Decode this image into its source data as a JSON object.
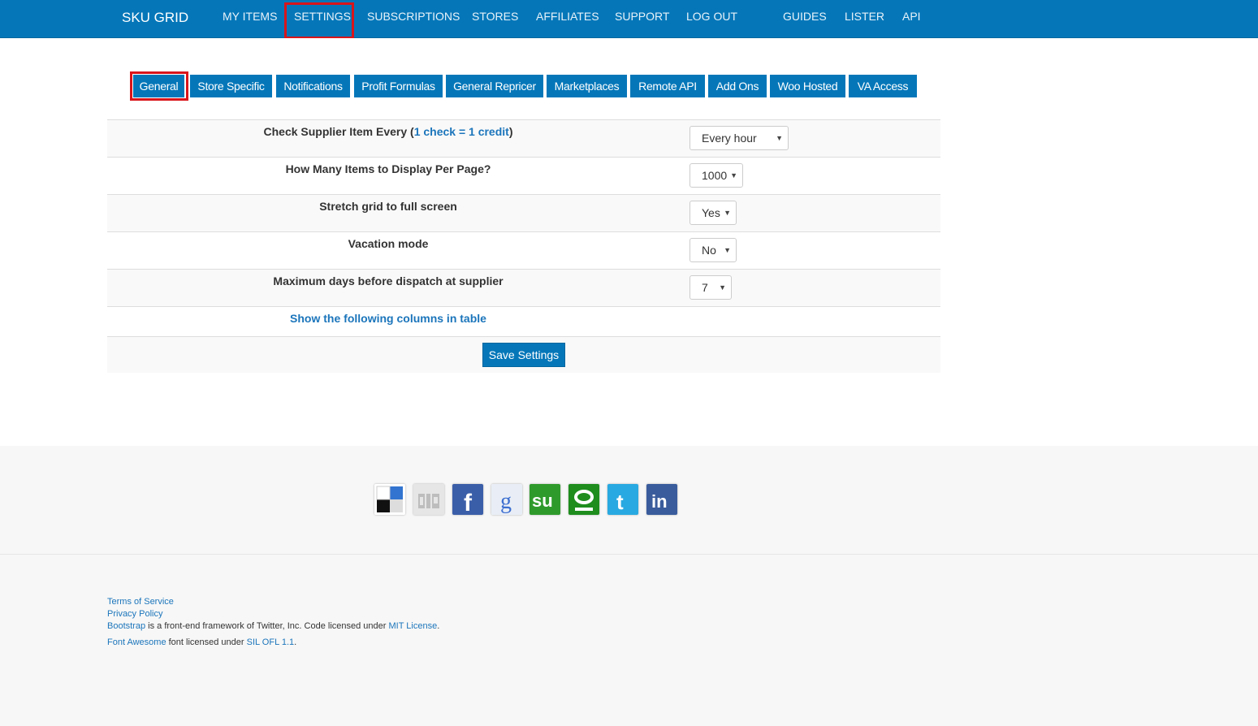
{
  "header": {
    "brand": "SKU GRID",
    "nav": [
      "MY ITEMS",
      "SETTINGS",
      "SUBSCRIPTIONS",
      "STORES",
      "AFFILIATES",
      "SUPPORT",
      "LOG OUT",
      "GUIDES",
      "LISTER",
      "API"
    ],
    "active": "SETTINGS",
    "bg_color": "#0577b9"
  },
  "tabs": [
    "General",
    "Store Specific",
    "Notifications",
    "Profit Formulas",
    "General Repricer",
    "Marketplaces",
    "Remote API",
    "Add Ons",
    "Woo Hosted",
    "VA Access"
  ],
  "settings": {
    "rows": [
      {
        "label_pre": "Check Supplier Item Every (",
        "label_link": "1 check = 1 credit",
        "label_post": ")",
        "value": "Every hour"
      },
      {
        "label": "How Many Items to Display Per Page?",
        "value": "1000"
      },
      {
        "label": "Stretch grid to full screen",
        "value": "Yes"
      },
      {
        "label": "Vacation mode",
        "value": "No"
      },
      {
        "label": "Maximum days before dispatch at supplier",
        "value": "7"
      }
    ],
    "columns_link": "Show the following columns in table",
    "save_label": "Save Settings"
  },
  "share_icons": [
    "delicious-icon",
    "digg-icon",
    "facebook-icon",
    "google-icon",
    "stumbleupon-icon",
    "technorati-icon",
    "twitter-icon",
    "linkedin-icon"
  ],
  "footer": {
    "terms": "Terms of Service",
    "privacy": "Privacy Policy",
    "bootstrap_link": "Bootstrap",
    "bootstrap_text": " is a front-end framework of Twitter, Inc. Code licensed under ",
    "mit_link": "MIT License",
    "dot": ".",
    "fa_link": "Font Awesome",
    "fa_text": " font licensed under ",
    "ofl_link": "SIL OFL 1.1",
    "dot2": "."
  }
}
